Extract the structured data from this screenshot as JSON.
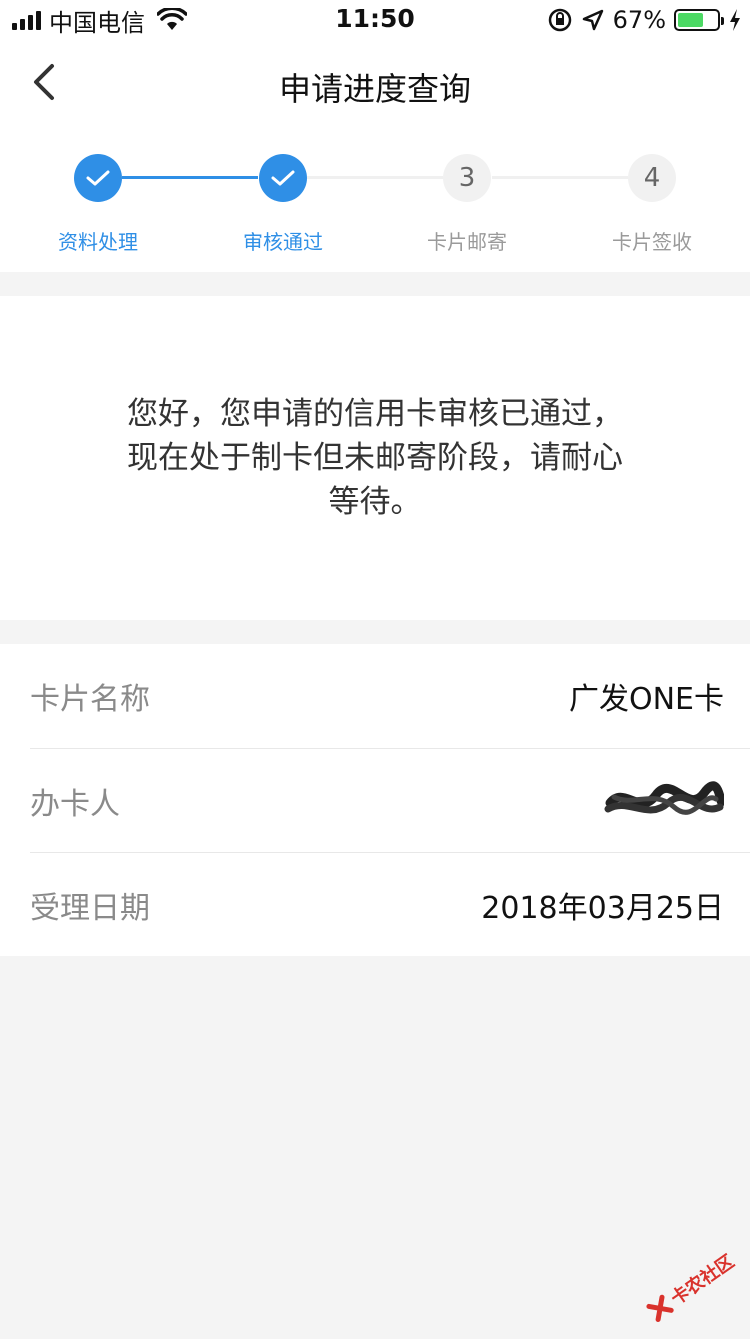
{
  "status_bar": {
    "carrier": "中国电信",
    "time": "11:50",
    "battery": "67%",
    "battery_level": 0.67
  },
  "nav": {
    "title": "申请进度查询"
  },
  "steps": [
    {
      "label": "资料处理",
      "state": "done",
      "number": ""
    },
    {
      "label": "审核通过",
      "state": "done",
      "number": ""
    },
    {
      "label": "卡片邮寄",
      "state": "todo",
      "number": "3"
    },
    {
      "label": "卡片签收",
      "state": "todo",
      "number": "4"
    }
  ],
  "message": {
    "line1": "您好，您申请的信用卡审核已通过，",
    "line2": "现在处于制卡但未邮寄阶段，请耐心",
    "line3": "等待。"
  },
  "info": {
    "card_name_label": "卡片名称",
    "card_name_value": "广发ONE卡",
    "applicant_label": "办卡人",
    "date_label": "受理日期",
    "date_value": "2018年03月25日"
  },
  "watermark": {
    "text": "卡农社区"
  },
  "colors": {
    "accent": "#2f8fe6",
    "inactive_step": "#f1f1f1",
    "background": "#f4f4f4"
  }
}
